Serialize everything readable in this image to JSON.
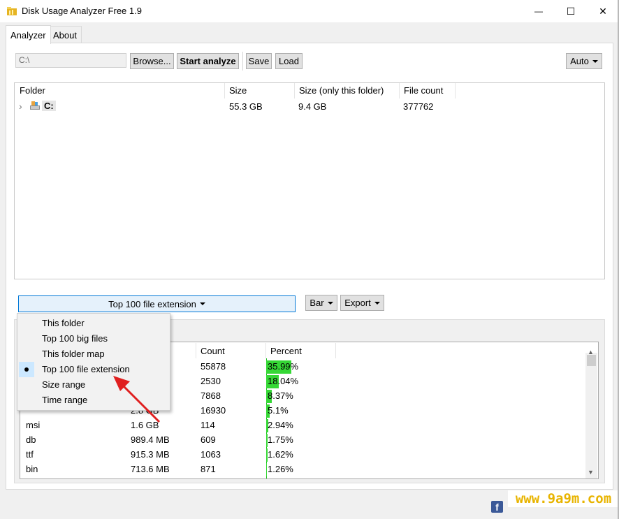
{
  "window": {
    "title": "Disk Usage Analyzer Free 1.9",
    "minimize": "—",
    "maximize": "☐",
    "close": "✕"
  },
  "tabs": [
    "Analyzer",
    "About"
  ],
  "toolbar": {
    "path_value": "C:\\",
    "browse_label": "Browse...",
    "start_label": "Start analyze",
    "save_label": "Save",
    "load_label": "Load",
    "auto_label": "Auto"
  },
  "tree": {
    "columns": [
      "Folder",
      "Size",
      "Size (only this folder)",
      "File count"
    ],
    "rows": [
      {
        "expander": "›",
        "folder": "C:",
        "size": "55.3 GB",
        "own_size": "9.4 GB",
        "file_count": "377762"
      }
    ]
  },
  "view_select": {
    "label": "Top 100 file extension",
    "bar_label": "Bar",
    "export_label": "Export"
  },
  "view_menu": {
    "items": [
      "This folder",
      "Top 100 big files",
      "This folder map",
      "Top 100 file extension",
      "Size range",
      "Time range"
    ],
    "selected_index": 3
  },
  "ext_list": {
    "columns": [
      "Count",
      "Percent"
    ],
    "rows": [
      {
        "ext": "",
        "size": "",
        "count": "55878",
        "percent": "35.99%",
        "fraction": 0.3599
      },
      {
        "ext": "",
        "size": "",
        "count": "2530",
        "percent": "18.04%",
        "fraction": 0.1804
      },
      {
        "ext": "",
        "size": "",
        "count": "7868",
        "percent": "8.37%",
        "fraction": 0.0837
      },
      {
        "ext": "",
        "size": "2.8 GB",
        "count": "16930",
        "percent": "5.1%",
        "fraction": 0.051
      },
      {
        "ext": "msi",
        "size": "1.6 GB",
        "count": "114",
        "percent": "2.94%",
        "fraction": 0.0294
      },
      {
        "ext": "db",
        "size": "989.4 MB",
        "count": "609",
        "percent": "1.75%",
        "fraction": 0.0175
      },
      {
        "ext": "ttf",
        "size": "915.3 MB",
        "count": "1063",
        "percent": "1.62%",
        "fraction": 0.0162
      },
      {
        "ext": "bin",
        "size": "713.6 MB",
        "count": "871",
        "percent": "1.26%",
        "fraction": 0.0126
      }
    ]
  },
  "footer": {
    "facebook_icon": "f",
    "watermark": "www.9a9m.com"
  },
  "colors": {
    "bar_fill": "#35d835",
    "annotation_arrow": "#e02020",
    "menu_highlight": "#cce8ff"
  }
}
